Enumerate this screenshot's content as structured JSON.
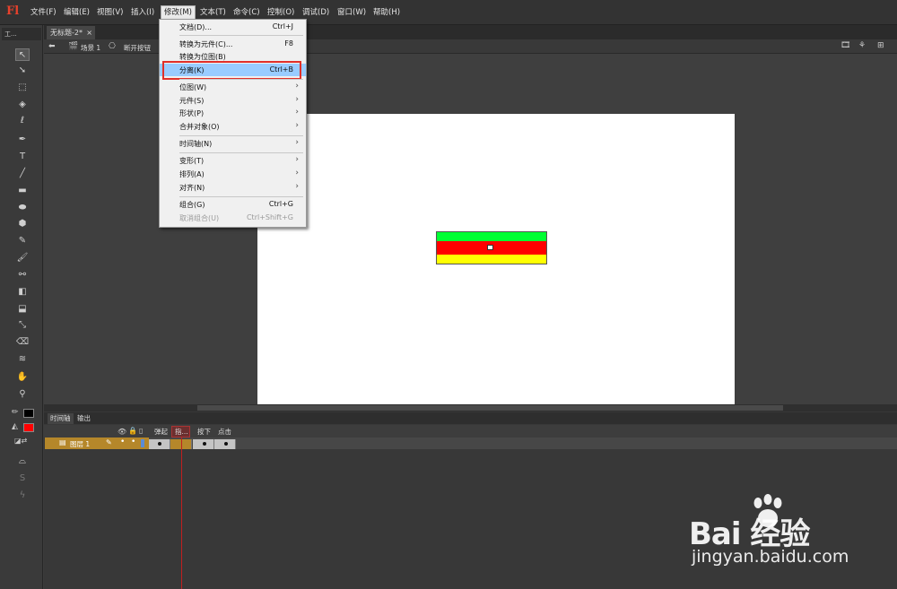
{
  "app": {
    "logo": "Fl"
  },
  "menubar": {
    "items": [
      "文件(F)",
      "编辑(E)",
      "视图(V)",
      "插入(I)",
      "修改(M)",
      "文本(T)",
      "命令(C)",
      "控制(O)",
      "调试(D)",
      "窗口(W)",
      "帮助(H)"
    ],
    "active": "修改(M)"
  },
  "toolbox": {
    "title": "工..."
  },
  "document": {
    "tab_label": "无标题-2*",
    "tab_close": "×"
  },
  "editbar": {
    "scene_label": "场景 1",
    "symbol_label": "断开按钮"
  },
  "modify_menu": {
    "items": [
      {
        "label": "文档(D)...",
        "shortcut": "Ctrl+J"
      },
      {
        "label": "转换为元件(C)...",
        "shortcut": "F8"
      },
      {
        "label": "转换为位图(B)",
        "shortcut": ""
      },
      {
        "label": "分离(K)",
        "shortcut": "Ctrl+B"
      },
      {
        "label": "位图(W)",
        "submenu": true
      },
      {
        "label": "元件(S)",
        "submenu": true
      },
      {
        "label": "形状(P)",
        "submenu": true
      },
      {
        "label": "合并对象(O)",
        "submenu": true
      },
      {
        "label": "时间轴(N)",
        "submenu": true
      },
      {
        "label": "变形(T)",
        "submenu": true
      },
      {
        "label": "排列(A)",
        "submenu": true
      },
      {
        "label": "对齐(N)",
        "submenu": true
      },
      {
        "label": "组合(G)",
        "shortcut": "Ctrl+G"
      },
      {
        "label": "取消组合(U)",
        "shortcut": "Ctrl+Shift+G",
        "disabled": true
      }
    ],
    "highlighted": "分离(K)",
    "submenu_arrow": "›"
  },
  "timeline": {
    "tabs": [
      "时间轴",
      "输出"
    ],
    "frame_labels": [
      "弹起",
      "指...",
      "按下",
      "点击"
    ],
    "layer_name": "图层 1"
  },
  "watermark": {
    "brand": "Bai  经验",
    "url": "jingyan.baidu.com"
  },
  "colors": {
    "accent_highlight": "#99ccff",
    "annotation": "#e0302a",
    "green": "#00ff33",
    "red": "#ff0000",
    "yellow": "#ffff00"
  }
}
